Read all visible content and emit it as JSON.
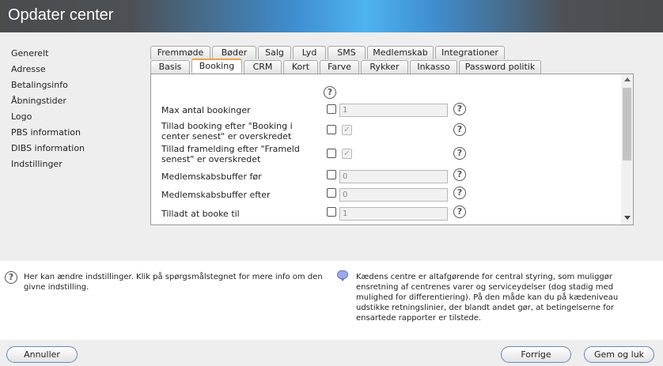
{
  "window": {
    "title": "Opdater center"
  },
  "sidebar": {
    "items": [
      {
        "label": "Generelt"
      },
      {
        "label": "Adresse"
      },
      {
        "label": "Betalingsinfo"
      },
      {
        "label": "Åbningstider"
      },
      {
        "label": "Logo"
      },
      {
        "label": "PBS information"
      },
      {
        "label": "DIBS information"
      },
      {
        "label": "Indstillinger"
      }
    ]
  },
  "tabs": {
    "row1": [
      "Fremmøde",
      "Bøder",
      "Salg",
      "Lyd",
      "SMS",
      "Medlemskab",
      "Integrationer"
    ],
    "row2": [
      "Basis",
      "Booking",
      "CRM",
      "Kort",
      "Farve",
      "Rykker",
      "Inkasso",
      "Password politik"
    ],
    "active": "Booking"
  },
  "settings": {
    "rows": [
      {
        "label": "Max antal bookinger",
        "value": "1"
      },
      {
        "label": "Tillad booking efter \"Booking i center senest\" er overskredet"
      },
      {
        "label": "Tillad framelding efter \"Frameld senest\" er overskredet"
      },
      {
        "label": "Medlemskabsbuffer før",
        "value": "0"
      },
      {
        "label": "Medlemskabsbuffer efter",
        "value": "0"
      },
      {
        "label": "Tilladt at booke til",
        "value": "1"
      }
    ]
  },
  "help_glyph": "?",
  "check_glyph": "✓",
  "info": {
    "left": "Her kan ændre indstillinger. Klik på spørgsmålstegnet for mere info om den givne indstilling.",
    "right": "Kædens centre er altafgørende for central styring, som muliggør ensretning af centrenes varer og serviceydelser (dog stadig med mulighed for differentiering). På den måde kan du på kædeniveau udstikke retningslinier, der blandt andet gør, at betingelserne for ensartede rapporter er tilstede."
  },
  "buttons": {
    "cancel": "Annuller",
    "previous": "Forrige",
    "save_close": "Gem og luk"
  },
  "colors": {
    "active_tab_accent": "#f0a04b",
    "title_gradient_center": "#4fb3f0"
  }
}
